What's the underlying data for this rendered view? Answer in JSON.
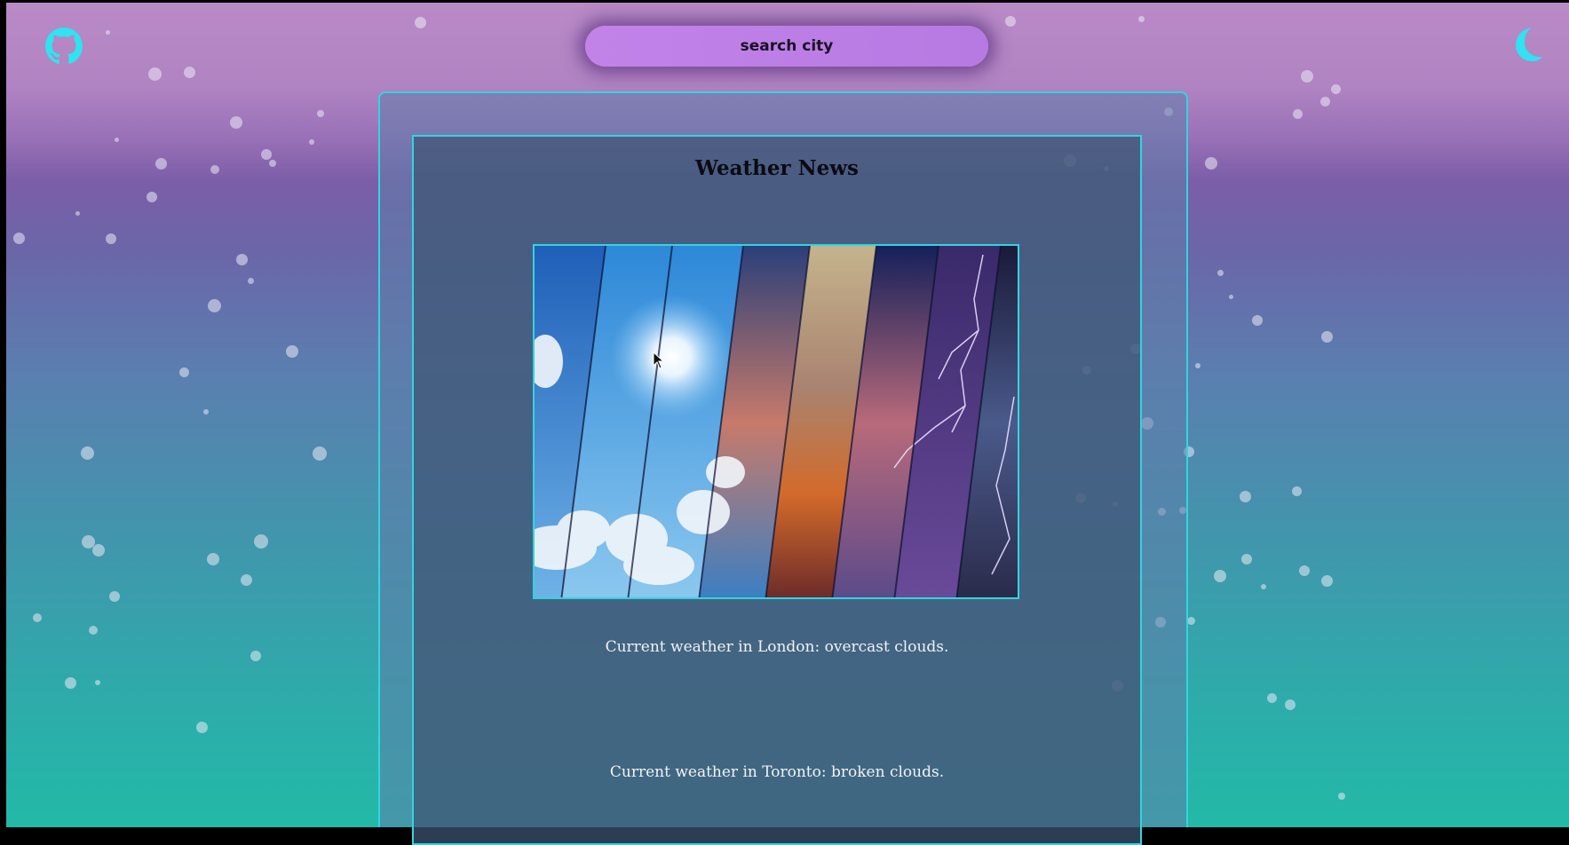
{
  "header": {
    "github_icon": "github-icon",
    "theme_toggle_icon": "moon-icon",
    "search": {
      "placeholder": "search city",
      "value": ""
    }
  },
  "news": {
    "title": "Weather News",
    "image_icon": "weather-collage-image",
    "items": [
      "Current weather in London: overcast clouds.",
      "Current weather in Toronto: broken clouds."
    ]
  },
  "colors": {
    "accent": "#2fd6e0",
    "search_bg": "#c283e9"
  }
}
